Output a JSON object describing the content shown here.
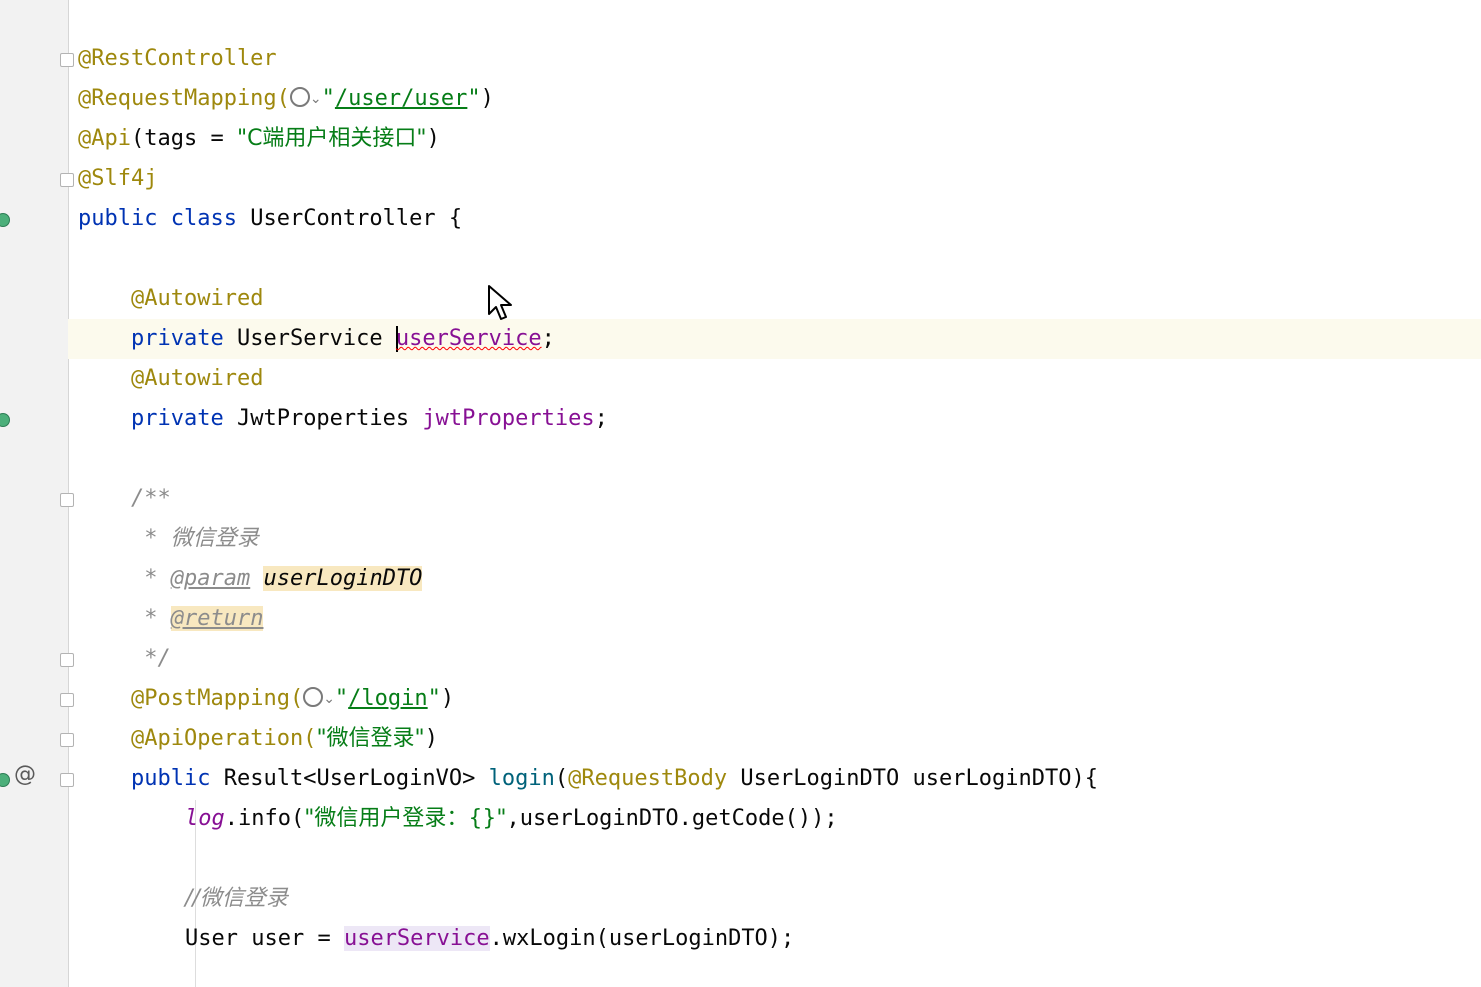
{
  "editor": {
    "language": "java",
    "lines": {
      "restcontroller": "@RestController",
      "requestmapping_anno": "@RequestMapping(",
      "requestmapping_path": "/user/user",
      "api_anno": "@Api",
      "api_open": "(tags = ",
      "api_tag": "\"C端用户相关接口\"",
      "api_close": ")",
      "slf4j": "@Slf4j",
      "public_kw": "public",
      "class_kw": "class",
      "class_name": "UserController {",
      "autowired1": "@Autowired",
      "private1": "private",
      "type1": " UserService ",
      "field1": "userService",
      "semi1": ";",
      "autowired2": "@Autowired",
      "private2": "private",
      "type2": " JwtProperties ",
      "field2": "jwtProperties",
      "semi2": ";",
      "doc_open": "/**",
      "doc_star1": " * ",
      "doc_text": "微信登录",
      "doc_star2": " * ",
      "doc_param_tag": "@param",
      "doc_param_name": "userLoginDTO",
      "doc_star3": " * ",
      "doc_return_tag": "@return",
      "doc_close": " */",
      "postmapping_anno": "@PostMapping(",
      "postmapping_path": "/login",
      "apiop_anno": "@ApiOperation(",
      "apiop_str": "\"微信登录\"",
      "apiop_close": ")",
      "public2": "public",
      "return_type": " Result<UserLoginVO> ",
      "method_name": "login",
      "paren_open": "(",
      "reqbody": "@RequestBody",
      "params": " UserLoginDTO userLoginDTO){",
      "log_field": "log",
      "log_call": ".info(",
      "log_str": "\"微信用户登录：{}\"",
      "log_rest": ",userLoginDTO.getCode());",
      "comment": "//微信登录",
      "user_decl": "User user = ",
      "user_field": "userService",
      "user_rest": ".wxLogin(userLoginDTO);"
    }
  },
  "colors": {
    "annotation": "#9e880d",
    "keyword": "#0033b3",
    "string": "#067d17",
    "field": "#871094",
    "comment": "#8c8c8c",
    "caret_line": "#fcfaed"
  },
  "icons": {
    "gutter": [
      "spring-bean-icon",
      "fold-marker-icon",
      "at-sign-icon"
    ],
    "inline": [
      "globe-icon",
      "chevron-down-icon"
    ],
    "pointer": "mouse-pointer-icon"
  }
}
